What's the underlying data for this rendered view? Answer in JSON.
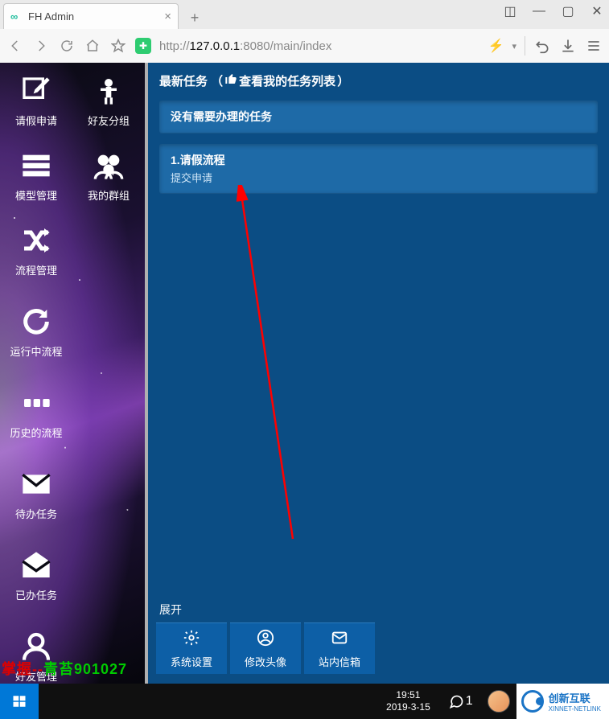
{
  "browser": {
    "tab_title": "FH Admin",
    "url_proto": "http://",
    "url_host": "127.0.0.1",
    "url_port": ":8080",
    "url_path": "/main/index"
  },
  "sidebar": {
    "items": [
      {
        "label": "请假申请",
        "icon": "edit"
      },
      {
        "label": "好友分组",
        "icon": "person"
      },
      {
        "label": "模型管理",
        "icon": "list"
      },
      {
        "label": "我的群组",
        "icon": "group"
      },
      {
        "label": "流程管理",
        "icon": "shuffle"
      },
      {
        "label": "运行中流程",
        "icon": "refresh"
      },
      {
        "label": "历史的流程",
        "icon": "dots"
      },
      {
        "label": "待办任务",
        "icon": "mail"
      },
      {
        "label": "已办任务",
        "icon": "mail-open"
      },
      {
        "label": "好友管理",
        "icon": "user"
      }
    ]
  },
  "main": {
    "heading_a": "最新任务 （",
    "heading_link": " 查看我的任务列表",
    "heading_b": "）",
    "card1": "没有需要办理的任务",
    "card2_title": "1.请假流程",
    "card2_sub": "提交申请",
    "expand": "展开",
    "buttons": [
      {
        "label": "系统设置",
        "icon": "gear"
      },
      {
        "label": "修改头像",
        "icon": "avatar"
      },
      {
        "label": "站内信箱",
        "icon": "inbox"
      }
    ]
  },
  "taskbar": {
    "time": "19:51",
    "date": "2019-3-15",
    "chat_count": "1",
    "brand": "创新互联",
    "brand_sub": "XINNET-NETLINK"
  },
  "watermark": {
    "a": "掌握--",
    "b": "青苔901027"
  }
}
